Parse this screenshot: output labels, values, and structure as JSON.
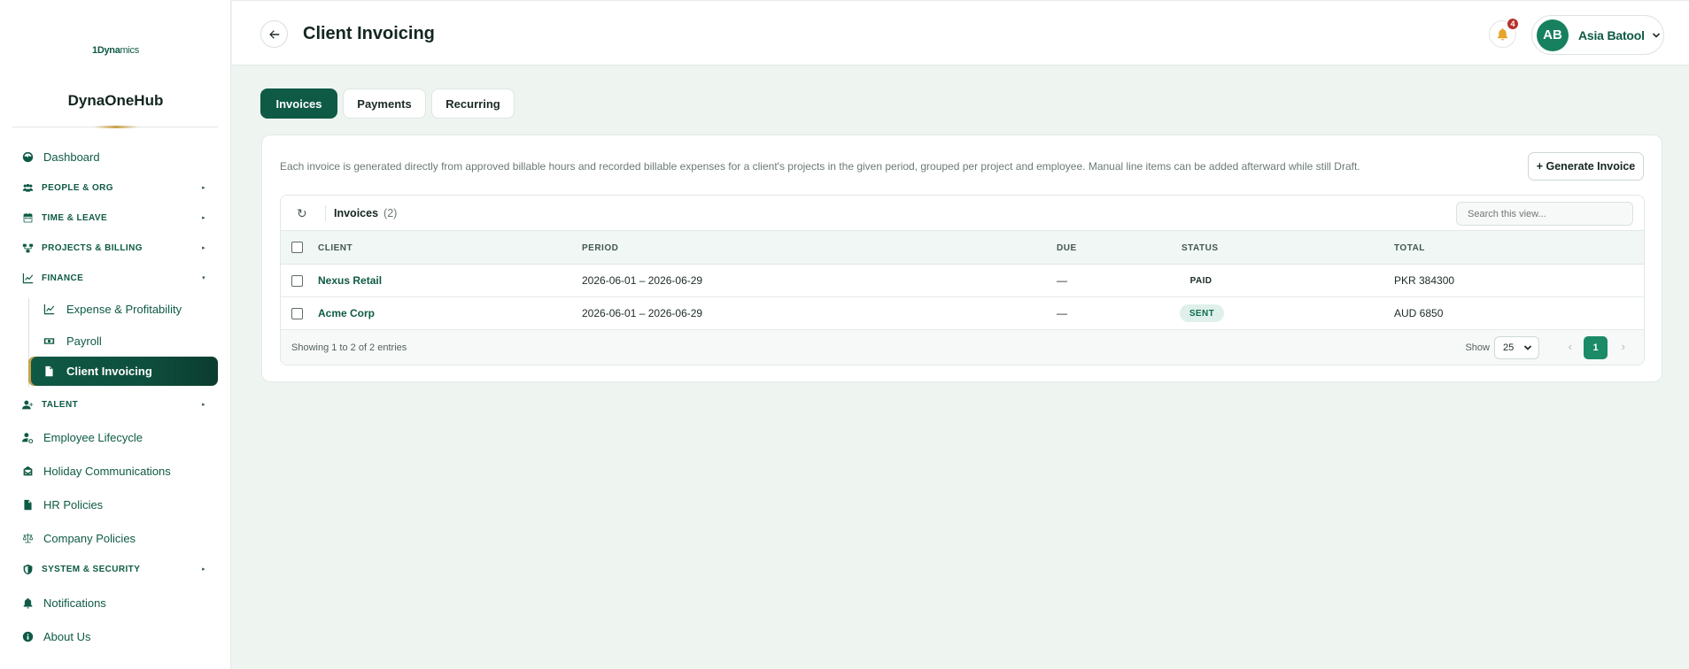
{
  "sidebar": {
    "logo_prefix": "1Dyna",
    "logo_suffix": "mics",
    "brand": "DynaOneHub",
    "items": [
      {
        "label": "Dashboard",
        "icon": "dashboard-icon"
      },
      {
        "label": "PEOPLE & ORG",
        "icon": "people-icon"
      },
      {
        "label": "TIME & LEAVE",
        "icon": "calendar-icon"
      },
      {
        "label": "PROJECTS & BILLING",
        "icon": "projects-icon"
      },
      {
        "label": "FINANCE",
        "icon": "chart-icon"
      },
      {
        "label": "Expense & Profitability",
        "icon": "chart-line-icon"
      },
      {
        "label": "Payroll",
        "icon": "money-icon"
      },
      {
        "label": "Client Invoicing",
        "icon": "document-icon"
      },
      {
        "label": "TALENT",
        "icon": "user-plus-icon"
      },
      {
        "label": "Employee Lifecycle",
        "icon": "user-cycle-icon"
      },
      {
        "label": "Holiday Communications",
        "icon": "mail-icon"
      },
      {
        "label": "HR Policies",
        "icon": "file-icon"
      },
      {
        "label": "Company Policies",
        "icon": "scale-icon"
      },
      {
        "label": "SYSTEM & SECURITY",
        "icon": "shield-icon"
      },
      {
        "label": "Notifications",
        "icon": "bell-icon"
      },
      {
        "label": "About Us",
        "icon": "info-icon"
      }
    ]
  },
  "header": {
    "title": "Client Invoicing",
    "notification_count": "4",
    "user_initials": "AB",
    "user_name": "Asia Batool"
  },
  "tabs": [
    {
      "label": "Invoices",
      "active": true
    },
    {
      "label": "Payments",
      "active": false
    },
    {
      "label": "Recurring",
      "active": false
    }
  ],
  "card": {
    "description": "Each invoice is generated directly from approved billable hours and recorded billable expenses for a client's projects in the given period, grouped per project and employee. Manual line items can be added afterward while still Draft.",
    "generate_button": "+ Generate Invoice"
  },
  "table": {
    "title": "Invoices",
    "count": "(2)",
    "search_placeholder": "Search this view...",
    "columns": [
      "CLIENT",
      "PERIOD",
      "DUE",
      "STATUS",
      "TOTAL"
    ],
    "rows": [
      {
        "client": "Nexus Retail",
        "period": "2026-06-01 – 2026-06-29",
        "due": "—",
        "status": "PAID",
        "total": "PKR 384300"
      },
      {
        "client": "Acme Corp",
        "period": "2026-06-01 – 2026-06-29",
        "due": "—",
        "status": "SENT",
        "total": "AUD 6850"
      }
    ],
    "showing": "Showing 1 to 2 of 2 entries",
    "show_label": "Show",
    "page_size": "25",
    "current_page": "1"
  },
  "colors": {
    "primary": "#0f5a45",
    "accent_gold": "#c9a24a",
    "badge_red": "#b7312a"
  }
}
